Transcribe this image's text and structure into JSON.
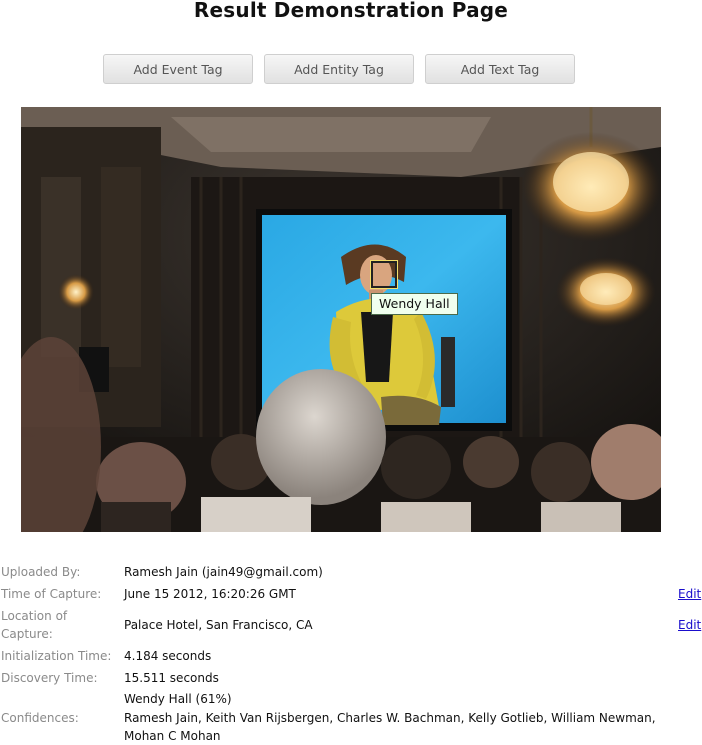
{
  "page": {
    "title": "Result Demonstration Page"
  },
  "toolbar": {
    "add_event_tag": "Add Event Tag",
    "add_entity_tag": "Add Entity Tag",
    "add_text_tag": "Add Text Tag"
  },
  "photo": {
    "face_tag_label": "Wendy Hall"
  },
  "info": {
    "uploaded_by": {
      "label": "Uploaded By:",
      "value": "Ramesh Jain (jain49@gmail.com)"
    },
    "time_of_capture": {
      "label": "Time of Capture:",
      "value": "June 15 2012, 16:20:26 GMT",
      "edit": "Edit"
    },
    "location_of_capture": {
      "label_line1": "Location of",
      "label_line2": "Capture:",
      "value": "Palace Hotel, San Francisco, CA",
      "edit": "Edit"
    },
    "initialization_time": {
      "label": "Initialization Time:",
      "value": "4.184 seconds"
    },
    "discovery_time": {
      "label": "Discovery Time:",
      "value": "15.511 seconds"
    },
    "confidences": {
      "label": "Confidences:",
      "top_match": "Wendy Hall (61%)",
      "others": "Ramesh Jain, Keith Van Rijsbergen, Charles W. Bachman, Kelly Gotlieb, William Newman, Mohan C Mohan"
    }
  },
  "colors": {
    "label_gray": "#8a8a8a",
    "link_blue": "#1a0dcc",
    "tag_box": "#f3df6a",
    "tag_label_bg": "#f0ffee"
  }
}
